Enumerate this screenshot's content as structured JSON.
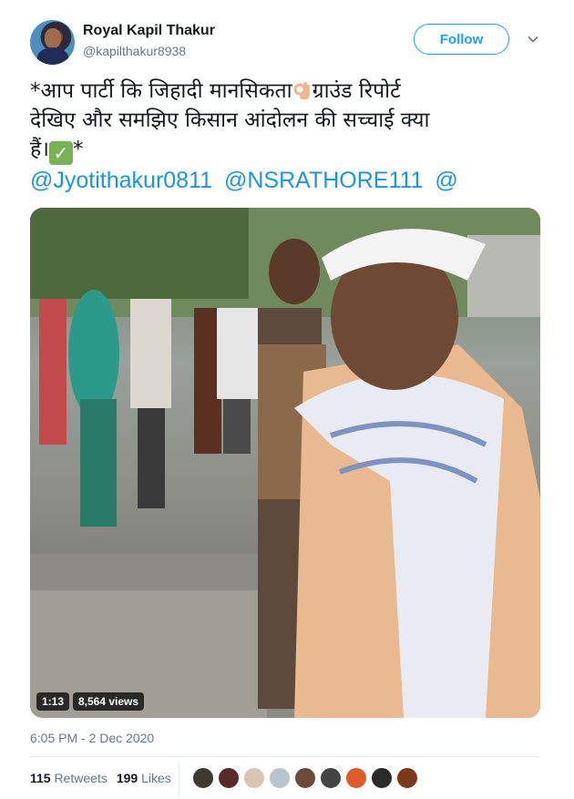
{
  "author": {
    "name": "Royal Kapil Thakur",
    "handle": "@kapilthakur8938",
    "follow_label": "Follow"
  },
  "tweet": {
    "line1_pre": "*आप पार्टी कि जिहादी मानसिकता",
    "line1_post": "ग्राउंड रिपोर्ट",
    "line2": "देखिए और समझिए किसान आंदोलन की सच्चाई क्या",
    "line3_pre": "हैं।",
    "line3_post": "*",
    "mentions": [
      "@Jyotithakur0811",
      "@NSRATHORE111",
      "@"
    ]
  },
  "media": {
    "duration": "1:13",
    "views": "8,564 views"
  },
  "timestamp": "6:05 PM - 2 Dec 2020",
  "stats": {
    "retweets_count": "115",
    "retweets_label": "Retweets",
    "likes_count": "199",
    "likes_label": "Likes"
  },
  "likers": [
    {
      "icon": "user-avatar",
      "color": "#3b3b2e"
    },
    {
      "icon": "user-avatar",
      "color": "#5a2a2a"
    },
    {
      "icon": "user-avatar",
      "color": "#d8c6b3"
    },
    {
      "icon": "default-avatar",
      "color": "#b8c4cc"
    },
    {
      "icon": "user-avatar",
      "color": "#6b4a3a"
    },
    {
      "icon": "user-avatar",
      "color": "#444444"
    },
    {
      "icon": "user-avatar",
      "color": "#e05a2a"
    },
    {
      "icon": "user-avatar",
      "color": "#2a2a2a"
    },
    {
      "icon": "user-avatar",
      "color": "#7a3a1a"
    }
  ],
  "colors": {
    "accent": "#1da1f2",
    "mention": "#1b95e0",
    "secondary_text": "#657786"
  }
}
